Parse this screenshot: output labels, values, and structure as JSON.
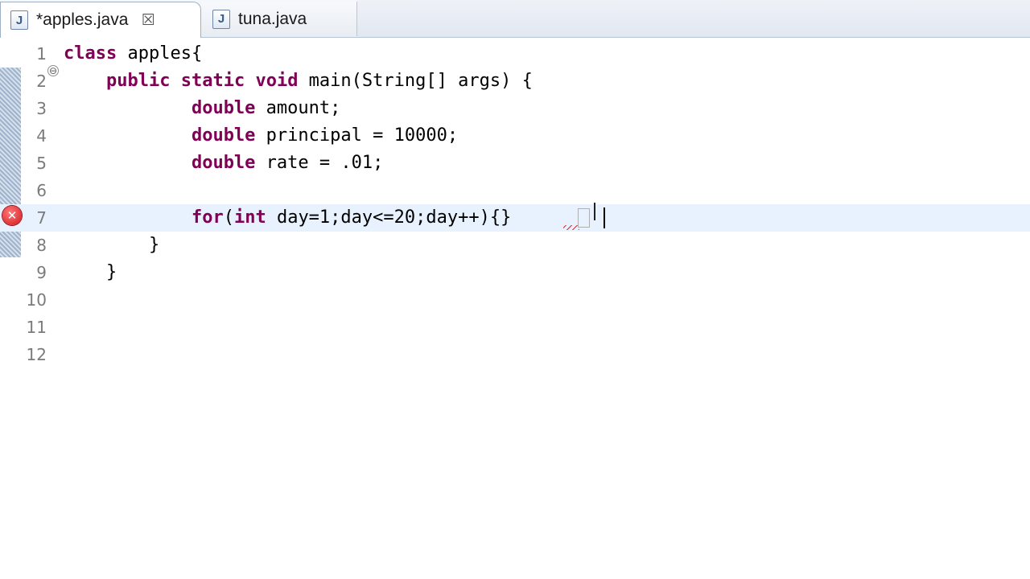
{
  "tabs": [
    {
      "label": "*apples.java",
      "icon": "java-file-icon",
      "active": true,
      "close_glyph": "☒"
    },
    {
      "label": "tuna.java",
      "icon": "java-file-icon",
      "active": false
    }
  ],
  "java_icon_letter": "J",
  "editor": {
    "current_line": 7,
    "error_line": 7,
    "lines": [
      {
        "number": "1",
        "text": "class apples{"
      },
      {
        "number": "2",
        "text": "    public static void main(String[] args) {"
      },
      {
        "number": "3",
        "text": "            double amount;"
      },
      {
        "number": "4",
        "text": "            double principal = 10000;"
      },
      {
        "number": "5",
        "text": "            double rate = .01;"
      },
      {
        "number": "6",
        "text": ""
      },
      {
        "number": "7",
        "text": "            for(int day=1;day<=20;day++){}"
      },
      {
        "number": "8",
        "text": "        }"
      },
      {
        "number": "9",
        "text": "    }"
      },
      {
        "number": "10",
        "text": ""
      },
      {
        "number": "11",
        "text": ""
      },
      {
        "number": "12",
        "text": ""
      }
    ],
    "error_marker": "x-icon",
    "fold_marker": "⊖"
  }
}
